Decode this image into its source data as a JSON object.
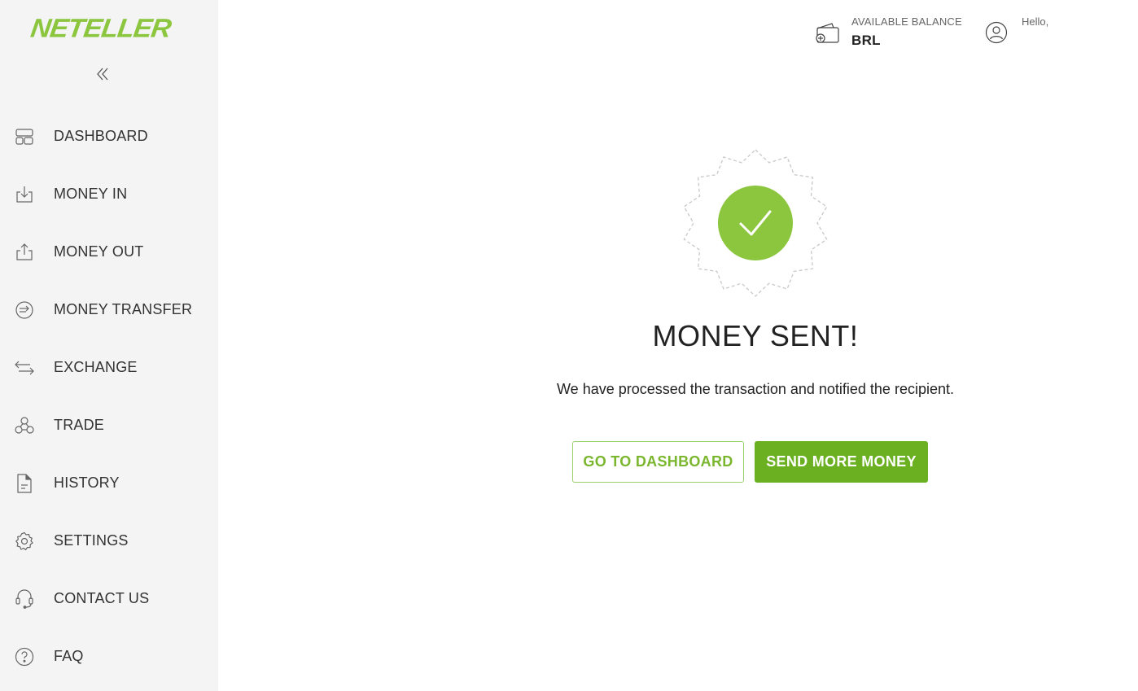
{
  "brand": {
    "logo_text": "NETELLER",
    "accent": "#8cc63f",
    "button_green": "#6ab020"
  },
  "sidebar": {
    "collapse_icon": "double-chevron-left-icon",
    "items": [
      {
        "label": "DASHBOARD",
        "icon": "dashboard-icon"
      },
      {
        "label": "MONEY IN",
        "icon": "download-tray-icon"
      },
      {
        "label": "MONEY OUT",
        "icon": "upload-tray-icon"
      },
      {
        "label": "MONEY TRANSFER",
        "icon": "transfer-circle-icon"
      },
      {
        "label": "EXCHANGE",
        "icon": "exchange-arrows-icon"
      },
      {
        "label": "TRADE",
        "icon": "trade-nodes-icon"
      },
      {
        "label": "HISTORY",
        "icon": "document-icon"
      },
      {
        "label": "SETTINGS",
        "icon": "gear-icon"
      },
      {
        "label": "CONTACT US",
        "icon": "headset-icon"
      },
      {
        "label": "FAQ",
        "icon": "question-circle-icon"
      }
    ]
  },
  "header": {
    "balance_label": "AVAILABLE BALANCE",
    "balance_value": "BRL",
    "greeting": "Hello,"
  },
  "main": {
    "title": "MONEY SENT!",
    "message": "We have processed the transaction and notified the recipient.",
    "primary_button": "SEND MORE MONEY",
    "secondary_button": "GO TO DASHBOARD"
  }
}
